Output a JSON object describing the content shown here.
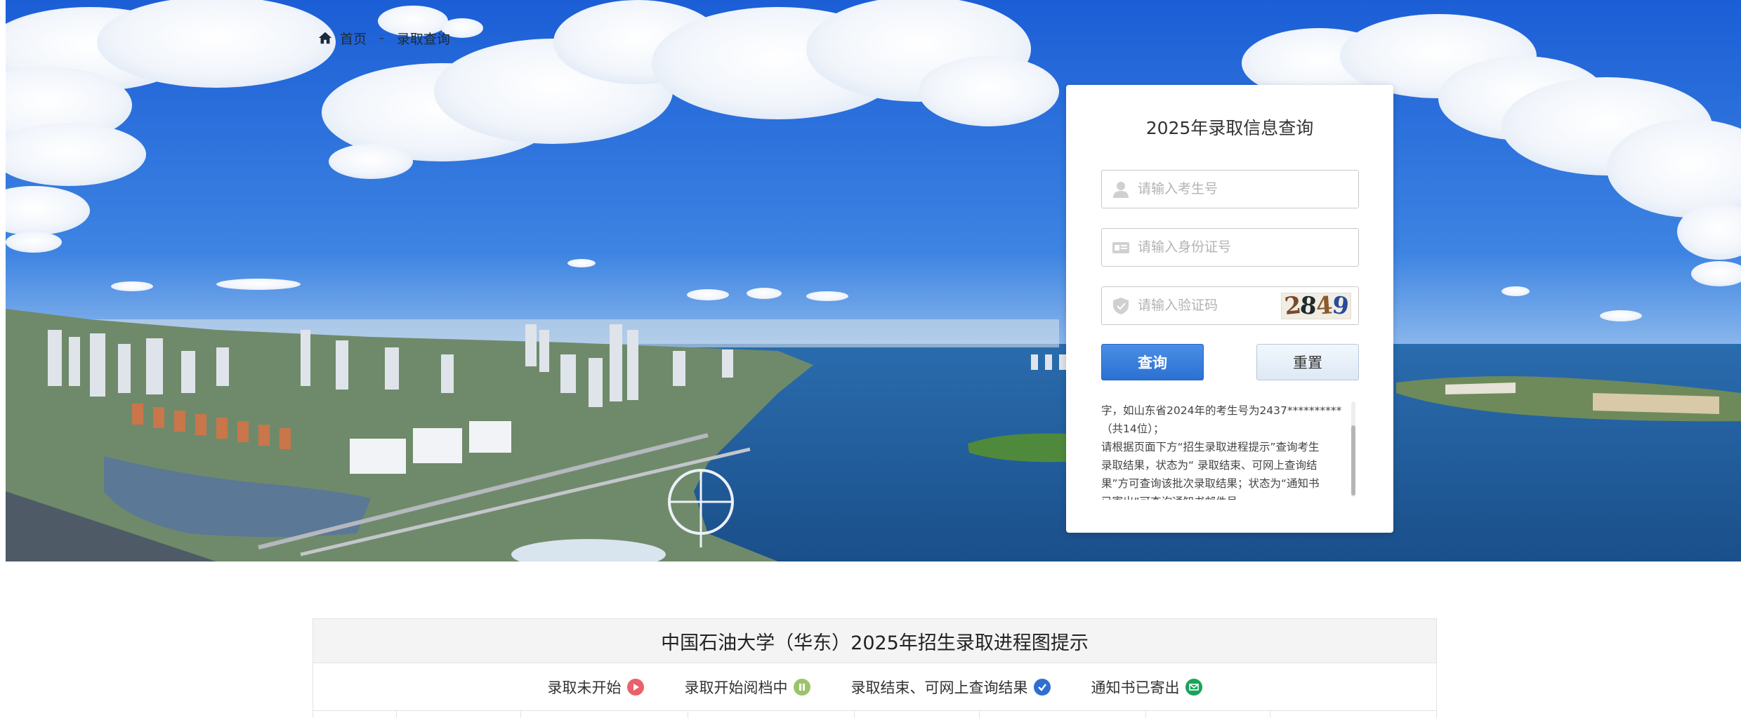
{
  "breadcrumb": {
    "home": "首页",
    "separator": "-",
    "current": "录取查询"
  },
  "query_card": {
    "title": "2025年录取信息查询",
    "exam_number_placeholder": "请输入考生号",
    "id_number_placeholder": "请输入身份证号",
    "captcha_placeholder": "请输入验证码",
    "captcha_chars": [
      "2",
      "8",
      "4",
      "9"
    ],
    "query_button": "查询",
    "reset_button": "重置",
    "notice_lines": [
      "字，如山东省2024年的考生号为2437**********",
      "（共14位）；",
      "请根据页面下方“招生录取进程提示”查询考生",
      "录取结果，状态为“ 录取结束、可网上查询结",
      "果”方可查询该批次录取结果；状态为“通知书",
      "已寄出”可查询通知书邮件号。"
    ]
  },
  "progress": {
    "title": "中国石油大学（华东）2025年招生录取进程图提示",
    "legend": [
      {
        "label": "录取未开始",
        "icon": "play-icon",
        "color": "#e9626b"
      },
      {
        "label": "录取开始阅档中",
        "icon": "pause-icon",
        "color": "#9bc46a"
      },
      {
        "label": "录取结束、可网上查询结果",
        "icon": "check-icon",
        "color": "#2f6fd0"
      },
      {
        "label": "通知书已寄出",
        "icon": "mail-icon",
        "color": "#1aa35a"
      }
    ]
  },
  "colors": {
    "primary_button": "#2c71d2",
    "accent_blue": "#2f6fd0"
  }
}
